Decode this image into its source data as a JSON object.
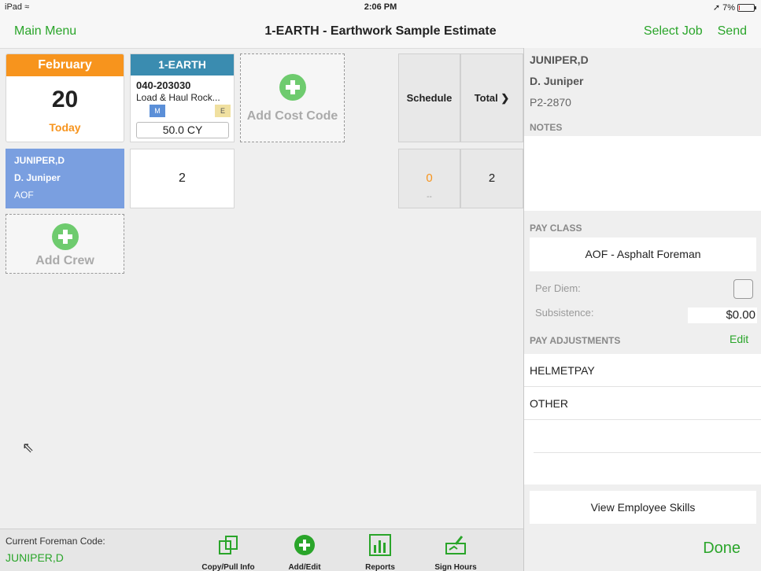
{
  "status_bar": {
    "device": "iPad",
    "time": "2:06 PM",
    "battery": "7%",
    "battery_level": 0.07
  },
  "nav": {
    "left": "Main Menu",
    "title": "1-EARTH - Earthwork Sample Estimate",
    "select_job": "Select Job",
    "send": "Send"
  },
  "date_tile": {
    "month": "February",
    "day": "20",
    "today": "Today"
  },
  "cost_code": {
    "job": "1-EARTH",
    "code": "040-203030",
    "description": "Load & Haul Rock...",
    "badge_m": "M",
    "badge_e": "E",
    "quantity": "50.0 CY"
  },
  "add_cost_code": "Add Cost Code",
  "crew": {
    "code": "JUNIPER,D",
    "name": "D. Juniper",
    "class": "AOF",
    "hours": "2"
  },
  "add_crew": "Add Crew",
  "columns": {
    "schedule": "Schedule",
    "total": "Total",
    "schedule_value": "0",
    "schedule_sub": "--",
    "total_value": "2"
  },
  "panel": {
    "code": "JUNIPER,D",
    "name": "D. Juniper",
    "id": "P2-2870",
    "notes_label": "NOTES",
    "pay_class_label": "PAY CLASS",
    "pay_class": "AOF - Asphalt Foreman",
    "per_diem_label": "Per Diem:",
    "subsistence_label": "Subsistence:",
    "subsistence_value": "$0.00",
    "pay_adjustments_label": "PAY ADJUSTMENTS",
    "edit": "Edit",
    "adjustments": [
      "HELMETPAY",
      "OTHER"
    ],
    "view_skills": "View Employee Skills",
    "done": "Done"
  },
  "footer": {
    "label": "Current Foreman Code:",
    "code": "JUNIPER,D",
    "tools": [
      "Copy/Pull Info",
      "Add/Edit",
      "Reports",
      "Sign Hours"
    ]
  },
  "colors": {
    "accent_green": "#2aa52a",
    "orange": "#f7941d",
    "job_blue": "#3a8cb0",
    "crew_blue": "#7a9fe0"
  }
}
